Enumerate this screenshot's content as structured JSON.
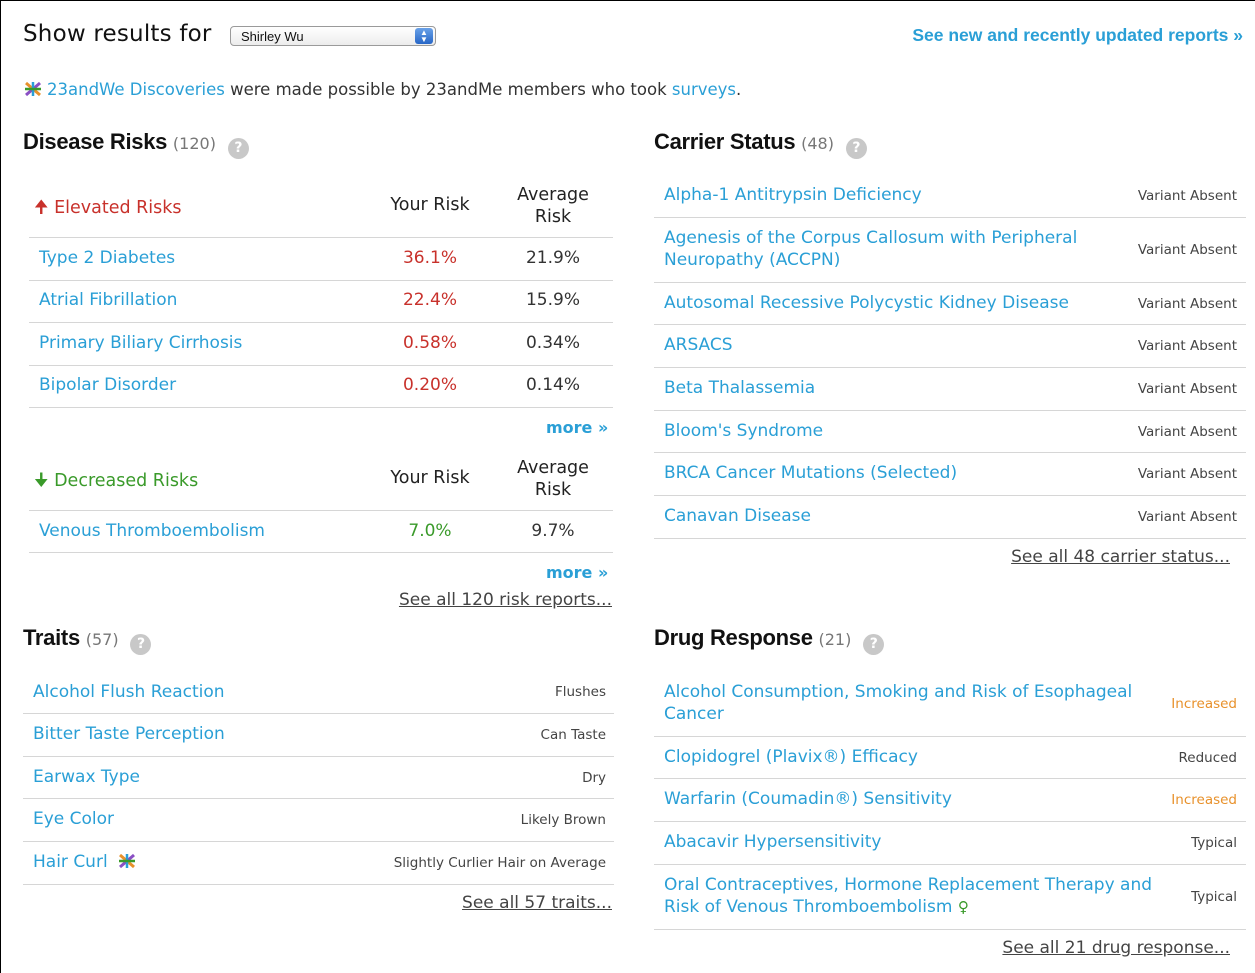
{
  "header": {
    "show_results_label": "Show results for",
    "profile_select_value": "Shirley Wu",
    "new_reports_link": "See new and recently updated reports »"
  },
  "intro": {
    "discoveries_link": "23andWe Discoveries",
    "middle_text": " were made possible by 23andMe members who took ",
    "surveys_link": "surveys",
    "end_text": "."
  },
  "disease_risks": {
    "title": "Disease Risks",
    "count": "(120)",
    "elevated": {
      "label": "Elevated Risks",
      "your_risk_header": "Your Risk",
      "average_risk_header": "Average Risk",
      "rows": [
        {
          "name": "Type 2 Diabetes",
          "your": "36.1%",
          "avg": "21.9%"
        },
        {
          "name": "Atrial Fibrillation",
          "your": "22.4%",
          "avg": "15.9%"
        },
        {
          "name": "Primary Biliary Cirrhosis",
          "your": "0.58%",
          "avg": "0.34%"
        },
        {
          "name": "Bipolar Disorder",
          "your": "0.20%",
          "avg": "0.14%"
        }
      ],
      "more": "more »"
    },
    "decreased": {
      "label": "Decreased Risks",
      "your_risk_header": "Your Risk",
      "average_risk_header": "Average Risk",
      "rows": [
        {
          "name": "Venous Thromboembolism",
          "your": "7.0%",
          "avg": "9.7%"
        }
      ],
      "more": "more »"
    },
    "see_all": "See all 120 risk reports..."
  },
  "carrier_status": {
    "title": "Carrier Status",
    "count": "(48)",
    "rows": [
      {
        "name": "Alpha-1 Antitrypsin Deficiency",
        "status": "Variant Absent"
      },
      {
        "name": "Agenesis of the Corpus Callosum with Peripheral Neuropathy (ACCPN)",
        "status": "Variant Absent"
      },
      {
        "name": "Autosomal Recessive Polycystic Kidney Disease",
        "status": "Variant Absent"
      },
      {
        "name": "ARSACS",
        "status": "Variant Absent"
      },
      {
        "name": "Beta Thalassemia",
        "status": "Variant Absent"
      },
      {
        "name": "Bloom's Syndrome",
        "status": "Variant Absent"
      },
      {
        "name": "BRCA Cancer Mutations (Selected)",
        "status": "Variant Absent"
      },
      {
        "name": "Canavan Disease",
        "status": "Variant Absent"
      }
    ],
    "see_all": "See all 48 carrier status..."
  },
  "traits": {
    "title": "Traits",
    "count": "(57)",
    "rows": [
      {
        "name": "Alcohol Flush Reaction",
        "value": "Flushes"
      },
      {
        "name": "Bitter Taste Perception",
        "value": "Can Taste"
      },
      {
        "name": "Earwax Type",
        "value": "Dry"
      },
      {
        "name": "Eye Color",
        "value": "Likely Brown"
      },
      {
        "name": "Hair Curl",
        "value": "Slightly Curlier Hair on Average"
      }
    ],
    "see_all": "See all 57 traits..."
  },
  "drug_response": {
    "title": "Drug Response",
    "count": "(21)",
    "rows": [
      {
        "name": "Alcohol Consumption, Smoking and Risk of Esophageal Cancer",
        "value": "Increased"
      },
      {
        "name": "Clopidogrel (Plavix®) Efficacy",
        "value": "Reduced"
      },
      {
        "name": "Warfarin (Coumadin®) Sensitivity",
        "value": "Increased"
      },
      {
        "name": "Abacavir Hypersensitivity",
        "value": "Typical"
      },
      {
        "name": "Oral Contraceptives, Hormone Replacement Therapy and Risk of Venous Thromboembolism",
        "value": "Typical"
      }
    ],
    "see_all": "See all 21 drug response..."
  },
  "colors": {
    "link": "#2a9fd6",
    "elevated": "#c8312b",
    "decreased": "#3a9a2a",
    "increased": "#e8912b"
  },
  "icons": [
    "discovery-icon",
    "help-icon",
    "arrow-up-icon",
    "arrow-down-icon",
    "female-symbol-icon",
    "select-arrows-icon"
  ]
}
